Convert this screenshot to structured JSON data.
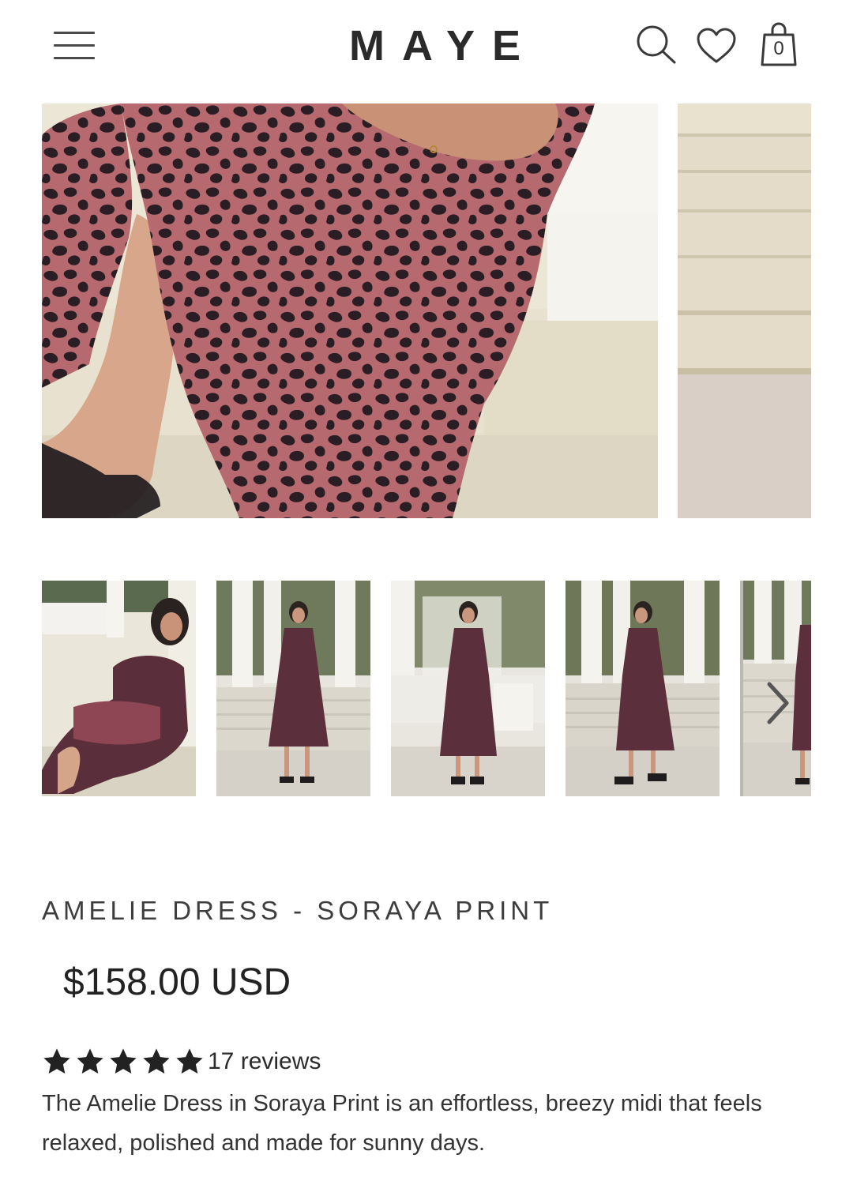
{
  "header": {
    "logo": "MAYE",
    "cart_count": "0"
  },
  "product": {
    "title": "AMELIE DRESS - SORAYA PRINT",
    "price": "$158.00 USD",
    "rating": 5,
    "reviews_label": "17 reviews",
    "description": "The Amelie Dress in Soraya Print is an effortless, breezy midi that feels relaxed, polished and made for sunny days."
  },
  "gallery": {
    "thumbnail_count": 5
  },
  "colors": {
    "dress_pink": "#b66a6f",
    "dress_dark": "#2b1d24",
    "text": "#2b2b2b",
    "background": "#ffffff"
  },
  "icons": [
    "menu-icon",
    "search-icon",
    "heart-icon",
    "bag-icon",
    "chevron-right-icon",
    "star-icon"
  ]
}
